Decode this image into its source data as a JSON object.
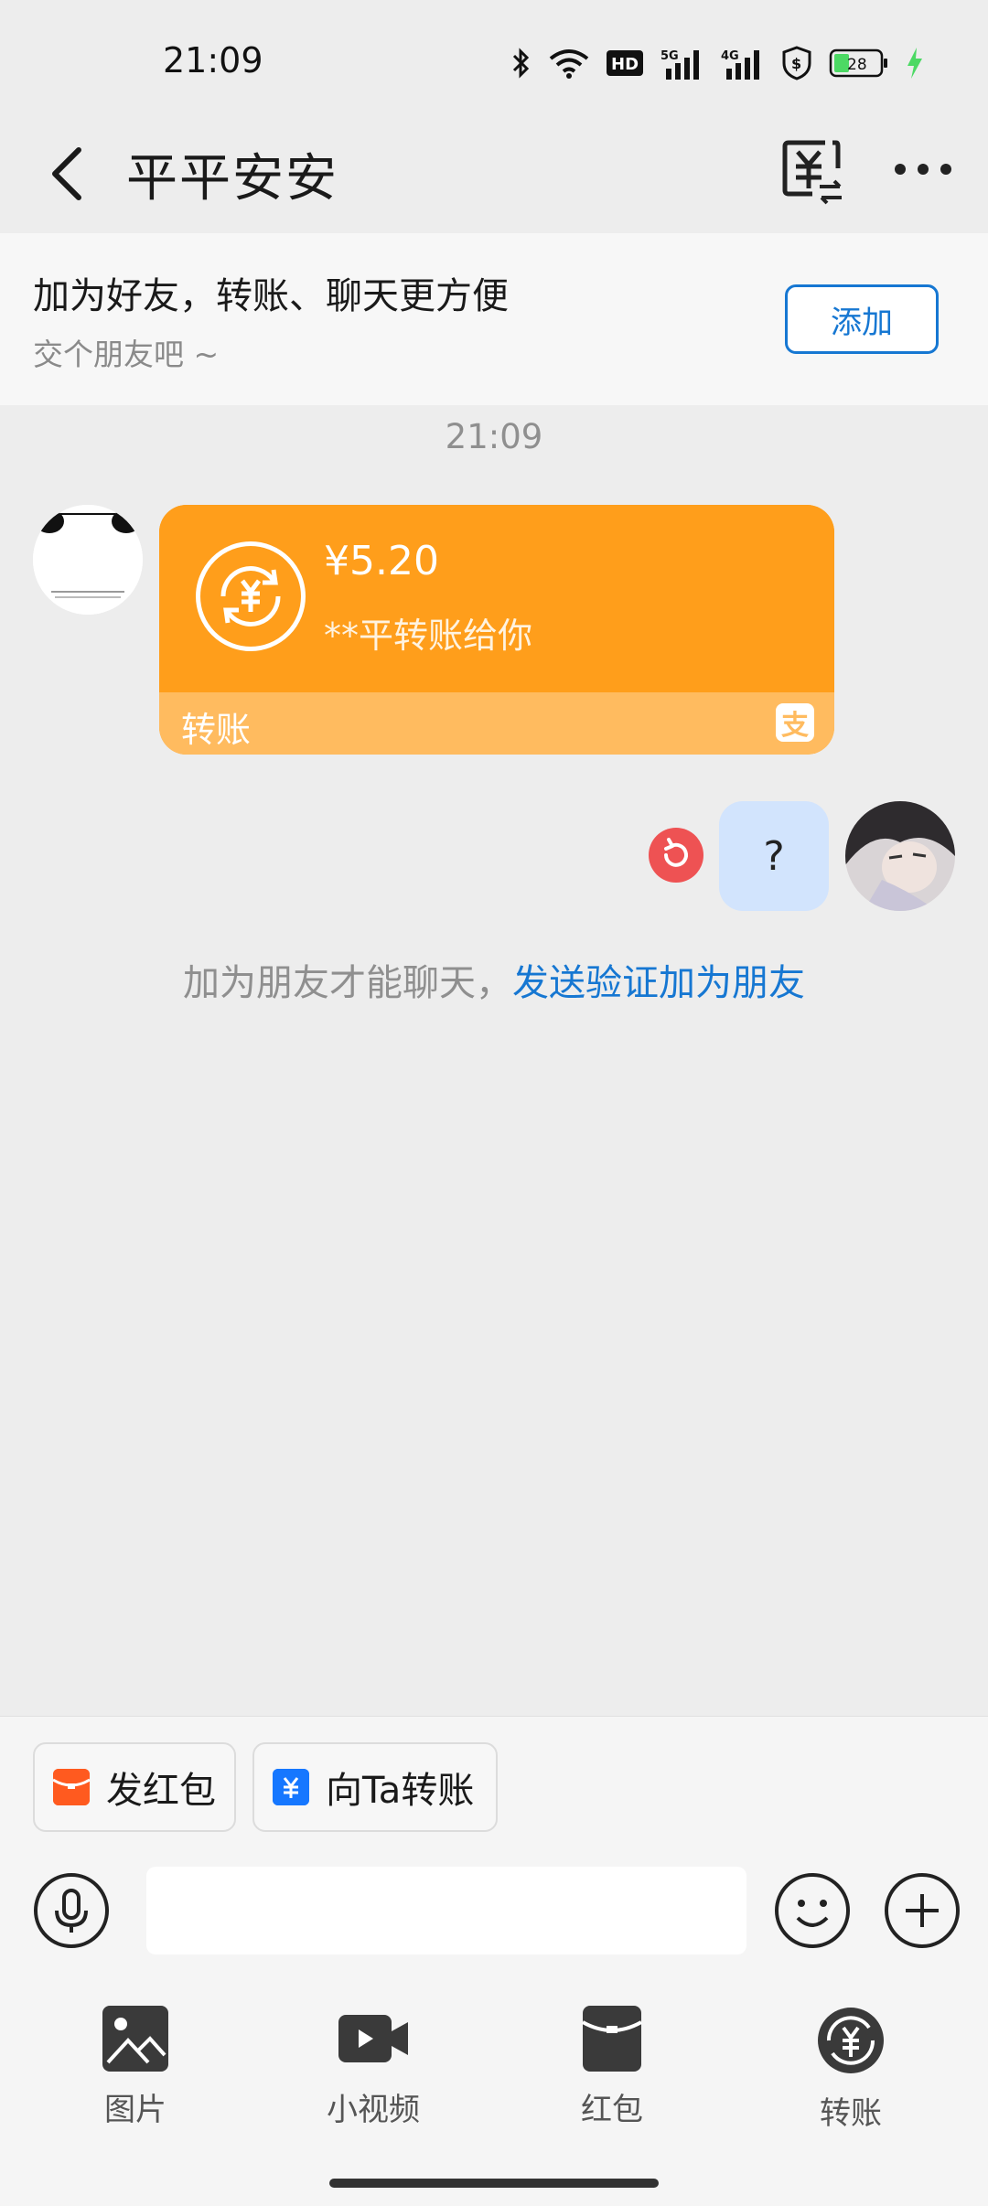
{
  "status_bar": {
    "time": "21:09",
    "icons": [
      "bluetooth-icon",
      "wifi-icon",
      "hd-icon",
      "signal-5g-icon",
      "signal-4g-icon",
      "shield-dollar-icon",
      "battery-icon",
      "charging-icon"
    ],
    "hd_text": "HD",
    "net1": "5G",
    "net2": "4G",
    "battery": "28"
  },
  "header": {
    "title": "平平安安",
    "accent": "#1a1a1a"
  },
  "banner": {
    "title": "加为好友，转账、聊天更方便",
    "subtitle": "交个朋友吧 ~",
    "add_label": "添加"
  },
  "chat": {
    "time": "21:09",
    "transfer": {
      "amount": "¥5.20",
      "description": "**平转账给你",
      "label": "转账",
      "color": "#ff9e1b"
    },
    "my_message": "?",
    "system_tip": "加为朋友才能聊天，",
    "system_link": "发送验证加为朋友"
  },
  "quick_actions": {
    "red_packet": "发红包",
    "transfer": "向Ta转账"
  },
  "input": {
    "placeholder": ""
  },
  "tools": {
    "photo": "图片",
    "video": "小视频",
    "red_packet": "红包",
    "transfer": "转账"
  },
  "colors": {
    "link": "#1677d2",
    "bubble": "#d2e4fd",
    "retry": "#ee5253"
  }
}
